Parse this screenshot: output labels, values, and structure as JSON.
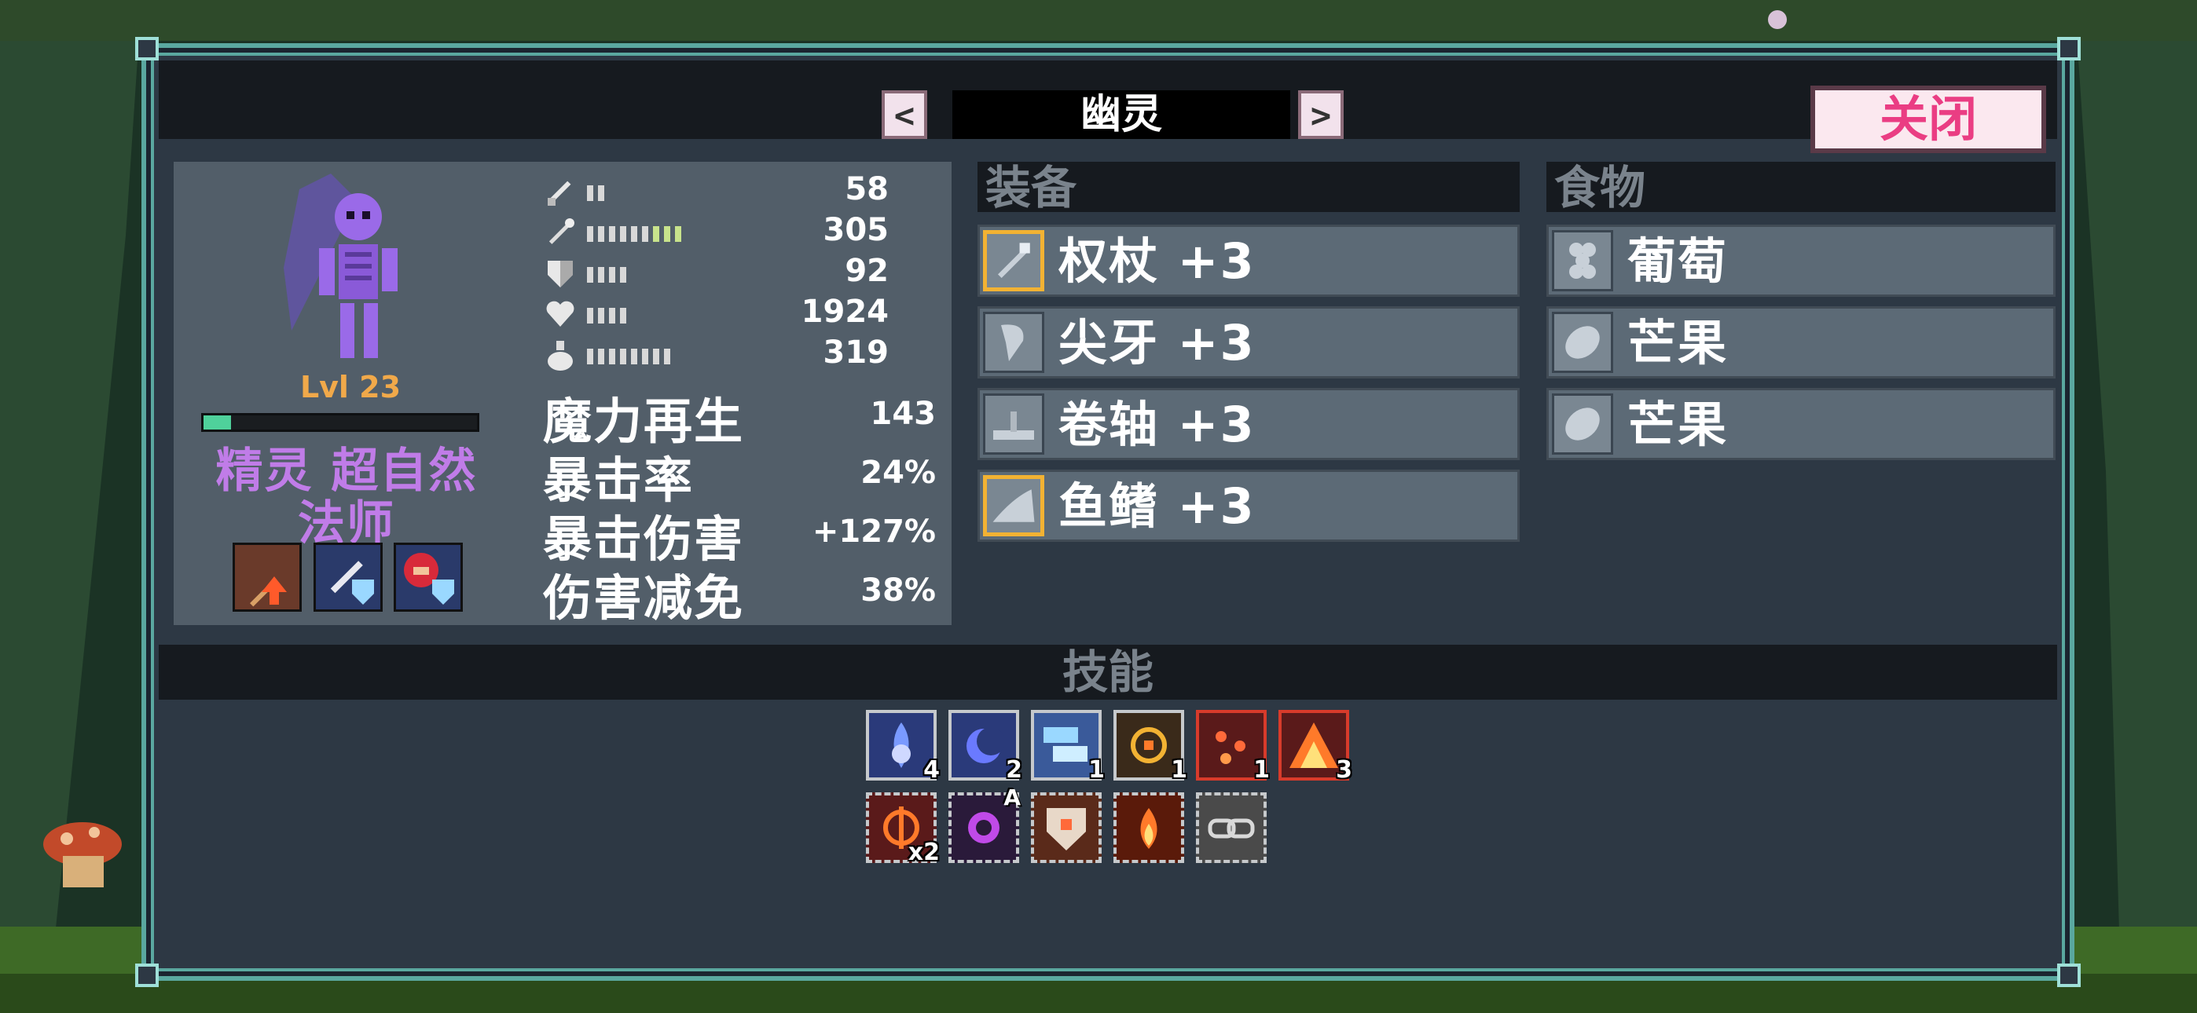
{
  "window": {
    "title": "幽灵",
    "prev_label": "<",
    "next_label": ">",
    "close_label": "关闭"
  },
  "character": {
    "level": "Lvl 23",
    "xp_fraction": 0.1,
    "class_line1": "精灵 超自然",
    "class_line2": "法师",
    "buffs": [
      "staff-buff-icon",
      "sword-shield-buff-icon",
      "hood-shield-buff-icon"
    ]
  },
  "stats": [
    {
      "icon": "sword-icon",
      "pips": 2,
      "green_pips": 0,
      "value": "58"
    },
    {
      "icon": "staff-icon",
      "pips": 6,
      "green_pips": 3,
      "value": "305"
    },
    {
      "icon": "shield-icon",
      "pips": 4,
      "green_pips": 0,
      "value": "92"
    },
    {
      "icon": "heart-icon",
      "pips": 4,
      "green_pips": 0,
      "value": "1924"
    },
    {
      "icon": "mana-flask-icon",
      "pips": 8,
      "green_pips": 0,
      "value": "319"
    }
  ],
  "substats": [
    {
      "label": "魔力再生",
      "value": "143"
    },
    {
      "label": "暴击率",
      "value": "24%"
    },
    {
      "label": "暴击伤害",
      "value": "+127%"
    },
    {
      "label": "伤害减免",
      "value": "38%"
    }
  ],
  "equipment": {
    "header": "装备",
    "items": [
      {
        "icon": "wand-icon",
        "label": "权杖 +3",
        "gold": true
      },
      {
        "icon": "fang-icon",
        "label": "尖牙 +3",
        "gold": false
      },
      {
        "icon": "scroll-icon",
        "label": "卷轴 +3",
        "gold": false
      },
      {
        "icon": "fin-icon",
        "label": "鱼鳍 +3",
        "gold": true
      }
    ]
  },
  "food": {
    "header": "食物",
    "items": [
      {
        "icon": "grape-icon",
        "label": "葡萄"
      },
      {
        "icon": "mango-icon",
        "label": "芒果"
      },
      {
        "icon": "mango-icon",
        "label": "芒果"
      }
    ]
  },
  "skills": {
    "header": "技能",
    "active": [
      {
        "icon": "spirit-flame-icon",
        "count": "4",
        "style": "normal"
      },
      {
        "icon": "moon-orb-icon",
        "count": "2",
        "style": "normal"
      },
      {
        "icon": "frost-cloud-icon",
        "count": "1",
        "style": "normal"
      },
      {
        "icon": "sun-sigil-icon",
        "count": "1",
        "style": "normal"
      },
      {
        "icon": "ember-sparks-icon",
        "count": "1",
        "style": "red"
      },
      {
        "icon": "fire-burst-icon",
        "count": "3",
        "style": "red"
      }
    ],
    "passive": [
      {
        "icon": "crosshair-icon",
        "count": "x2",
        "mark": ""
      },
      {
        "icon": "void-orb-icon",
        "count": "",
        "mark": "A"
      },
      {
        "icon": "rune-shield-icon",
        "count": "",
        "mark": ""
      },
      {
        "icon": "flame-icon",
        "count": "",
        "mark": ""
      },
      {
        "icon": "chain-link-icon",
        "count": "",
        "mark": ""
      }
    ]
  },
  "colors": {
    "panel": "#2d3844",
    "border": "#5aa8a0",
    "class_text": "#c07ce8",
    "level_text": "#f1a94a",
    "close_text": "#ea3d83",
    "gold_frame": "#f2b233"
  }
}
